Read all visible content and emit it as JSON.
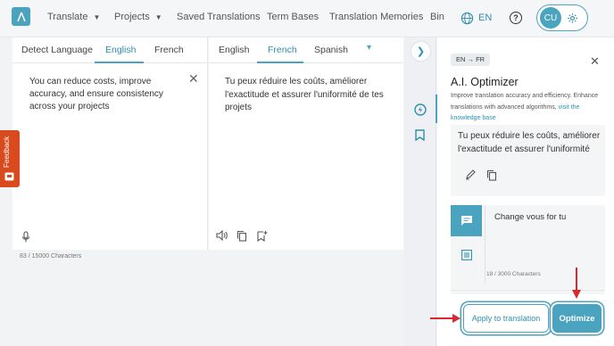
{
  "nav": {
    "items": [
      {
        "label": "Translate",
        "has_menu": true
      },
      {
        "label": "Projects",
        "has_menu": true
      },
      {
        "label": "Saved Translations"
      },
      {
        "label": "Term Bases"
      },
      {
        "label": "Translation Memories"
      },
      {
        "label": "Bin"
      }
    ],
    "ui_language": "EN",
    "user_initials": "CU"
  },
  "source": {
    "tabs": [
      "Detect Language",
      "English",
      "French"
    ],
    "active_tab": "English",
    "text": "You can reduce costs, improve accuracy, and ensure consistency across your projects",
    "char_count": "83 / 15000 Characters"
  },
  "target": {
    "tabs": [
      "English",
      "French",
      "Spanish"
    ],
    "active_tab": "French",
    "text": "Tu peux réduire les coûts, améliorer l'exactitude et assurer l'uniformité de tes projets"
  },
  "feedback": {
    "label": "Feedback"
  },
  "ai": {
    "lang_pair": "EN → FR",
    "title": "A.I. Optimizer",
    "description": "Improve translation accuracy and efficiency. Enhance translations with advanced algorithms,",
    "link_text": "visit the knowledge base",
    "preview_text": "Tu peux réduire les coûts, améliorer l'exactitude et assurer l'uniformité",
    "instruction_value": "Change vous for tu",
    "instruction_count": "18 / 3000 Characters",
    "apply_label": "Apply to translation",
    "optimize_label": "Optimize"
  },
  "colors": {
    "accent": "#4aa3bf",
    "feedback": "#d94a1e",
    "arrow": "#d9282f"
  }
}
